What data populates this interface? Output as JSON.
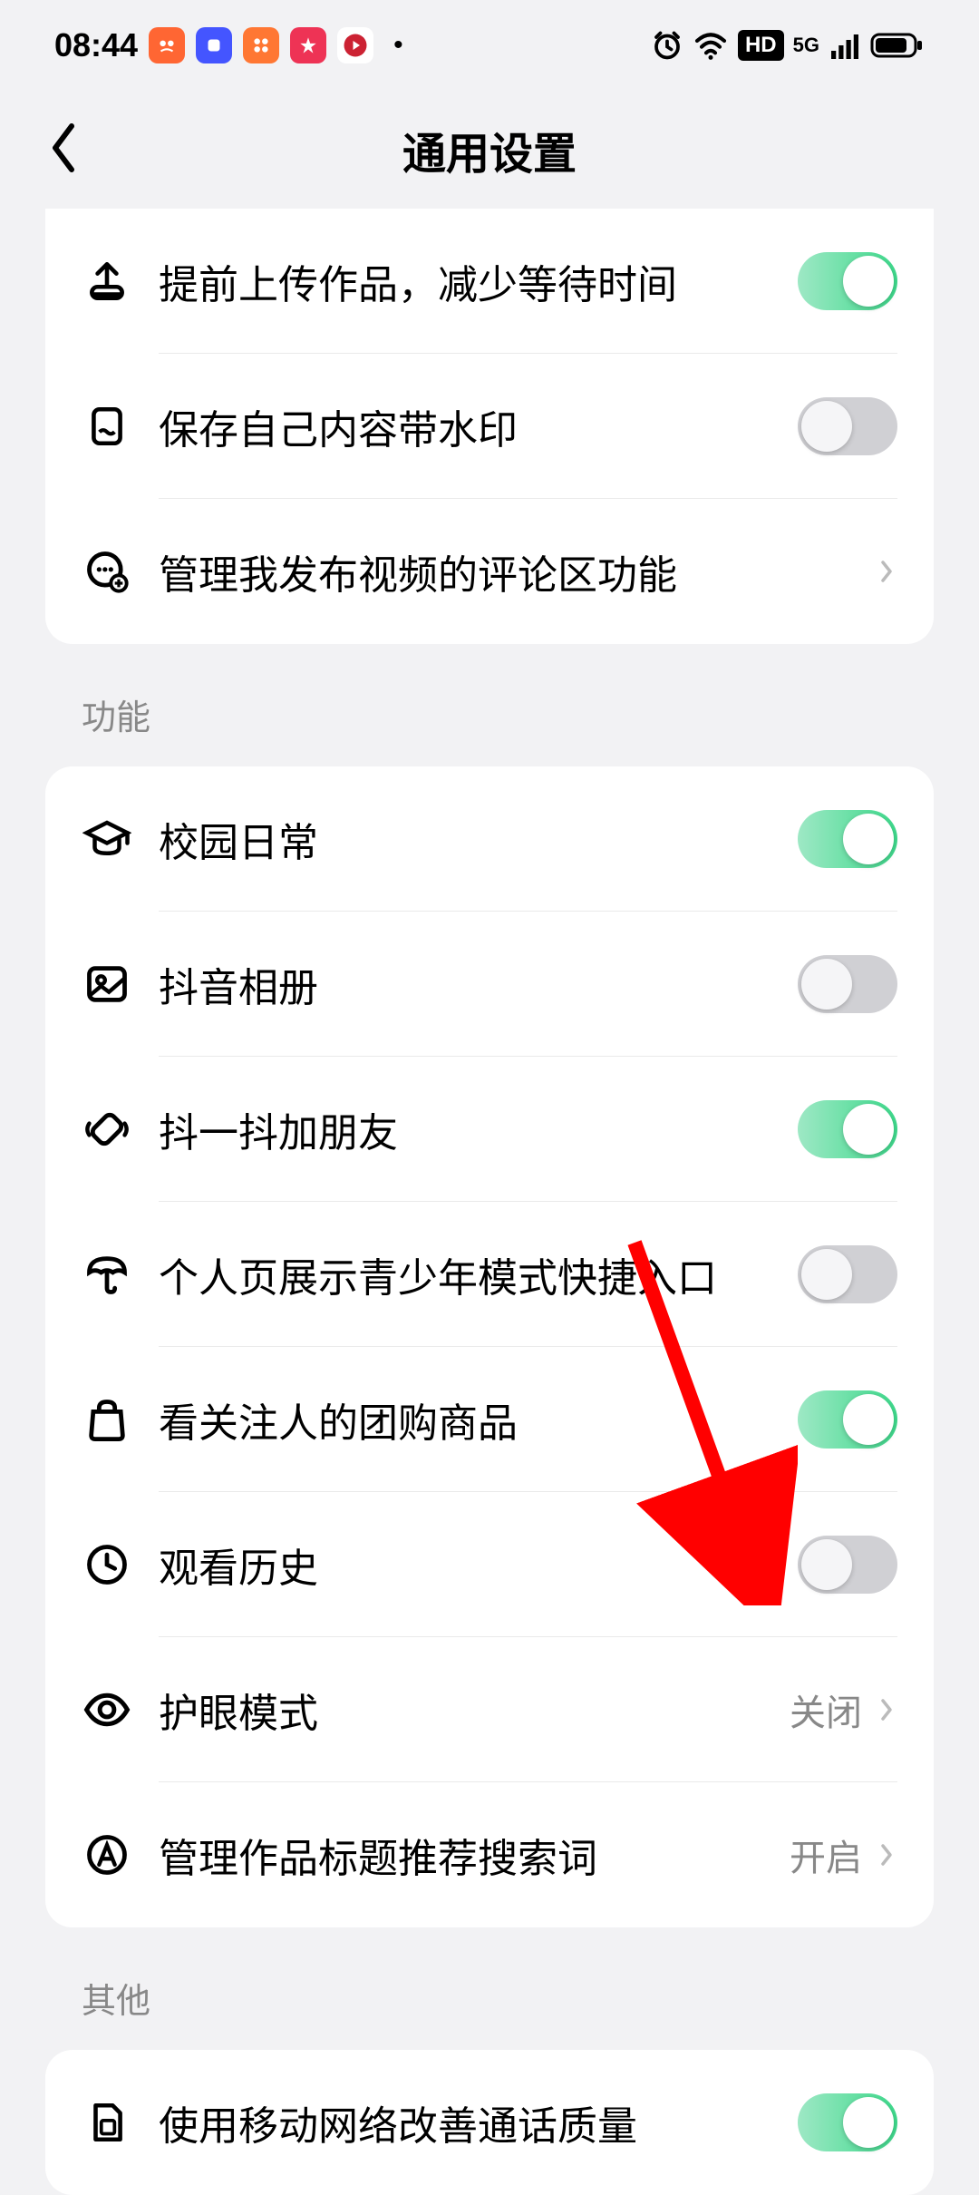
{
  "statusBar": {
    "time": "08:44"
  },
  "header": {
    "title": "通用设置"
  },
  "sections": {
    "main": {
      "uploadEarly": "提前上传作品，减少等待时间",
      "saveWatermark": "保存自己内容带水印",
      "manageComments": "管理我发布视频的评论区功能"
    },
    "features": {
      "title": "功能",
      "campusDaily": "校园日常",
      "douyinAlbum": "抖音相册",
      "shakeFriends": "抖一抖加朋友",
      "youthMode": "个人页展示青少年模式快捷入口",
      "groupBuyItems": "看关注人的团购商品",
      "watchHistory": "观看历史",
      "eyeMode": "护眼模式",
      "eyeModeValue": "关闭",
      "manageTitleKeywords": "管理作品标题推荐搜索词",
      "manageTitleKeywordsValue": "开启"
    },
    "other": {
      "title": "其他",
      "mobileCallQuality": "使用移动网络改善通话质量"
    }
  }
}
